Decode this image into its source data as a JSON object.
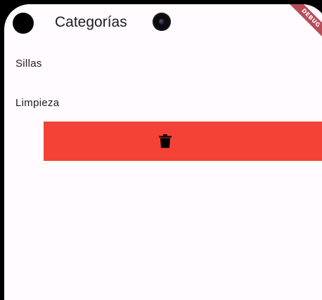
{
  "app_bar": {
    "title": "Categorías"
  },
  "debug_banner": {
    "label": "DEBUG"
  },
  "categories": [
    {
      "label": "Sillas"
    },
    {
      "label": "Limpieza"
    }
  ],
  "dismiss_background": {
    "color": "#f44336",
    "icon": "delete-icon"
  }
}
